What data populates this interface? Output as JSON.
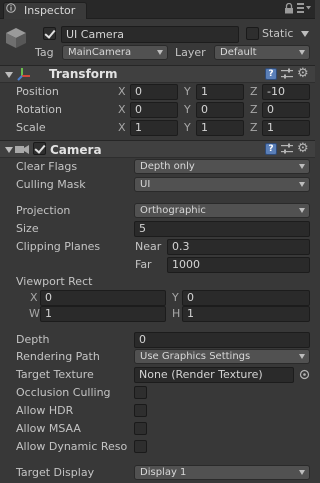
{
  "tab": {
    "label": "Inspector"
  },
  "gameobject": {
    "active": true,
    "name": "UI Camera",
    "static_label": "Static",
    "static_checked": false,
    "tag_label": "Tag",
    "tag_value": "MainCamera",
    "layer_label": "Layer",
    "layer_value": "Default"
  },
  "transform": {
    "title": "Transform",
    "rows": [
      {
        "label": "Position",
        "x": "0",
        "y": "1",
        "z": "-10"
      },
      {
        "label": "Rotation",
        "x": "0",
        "y": "0",
        "z": "0"
      },
      {
        "label": "Scale",
        "x": "1",
        "y": "1",
        "z": "1"
      }
    ],
    "axes": [
      "X",
      "Y",
      "Z"
    ]
  },
  "camera": {
    "title": "Camera",
    "enabled": true,
    "clear_flags": {
      "label": "Clear Flags",
      "value": "Depth only"
    },
    "culling_mask": {
      "label": "Culling Mask",
      "value": "UI"
    },
    "projection": {
      "label": "Projection",
      "value": "Orthographic"
    },
    "size": {
      "label": "Size",
      "value": "5"
    },
    "clipping": {
      "label": "Clipping Planes",
      "near_label": "Near",
      "near": "0.3",
      "far_label": "Far",
      "far": "1000"
    },
    "viewport": {
      "label": "Viewport Rect",
      "x_label": "X",
      "x": "0",
      "y_label": "Y",
      "y": "0",
      "w_label": "W",
      "w": "1",
      "h_label": "H",
      "h": "1"
    },
    "depth": {
      "label": "Depth",
      "value": "0"
    },
    "rendering_path": {
      "label": "Rendering Path",
      "value": "Use Graphics Settings"
    },
    "target_texture": {
      "label": "Target Texture",
      "value": "None (Render Texture)"
    },
    "occlusion_culling": {
      "label": "Occlusion Culling",
      "checked": false
    },
    "allow_hdr": {
      "label": "Allow HDR",
      "checked": false
    },
    "allow_msaa": {
      "label": "Allow MSAA",
      "checked": false
    },
    "allow_dynamic_reso": {
      "label": "Allow Dynamic Reso",
      "checked": false
    },
    "target_display": {
      "label": "Target Display",
      "value": "Display 1"
    }
  },
  "colors": {
    "background": "#383838",
    "field": "#2a2a2a",
    "dropdown": "#515151",
    "help": "#5a7fb8"
  }
}
